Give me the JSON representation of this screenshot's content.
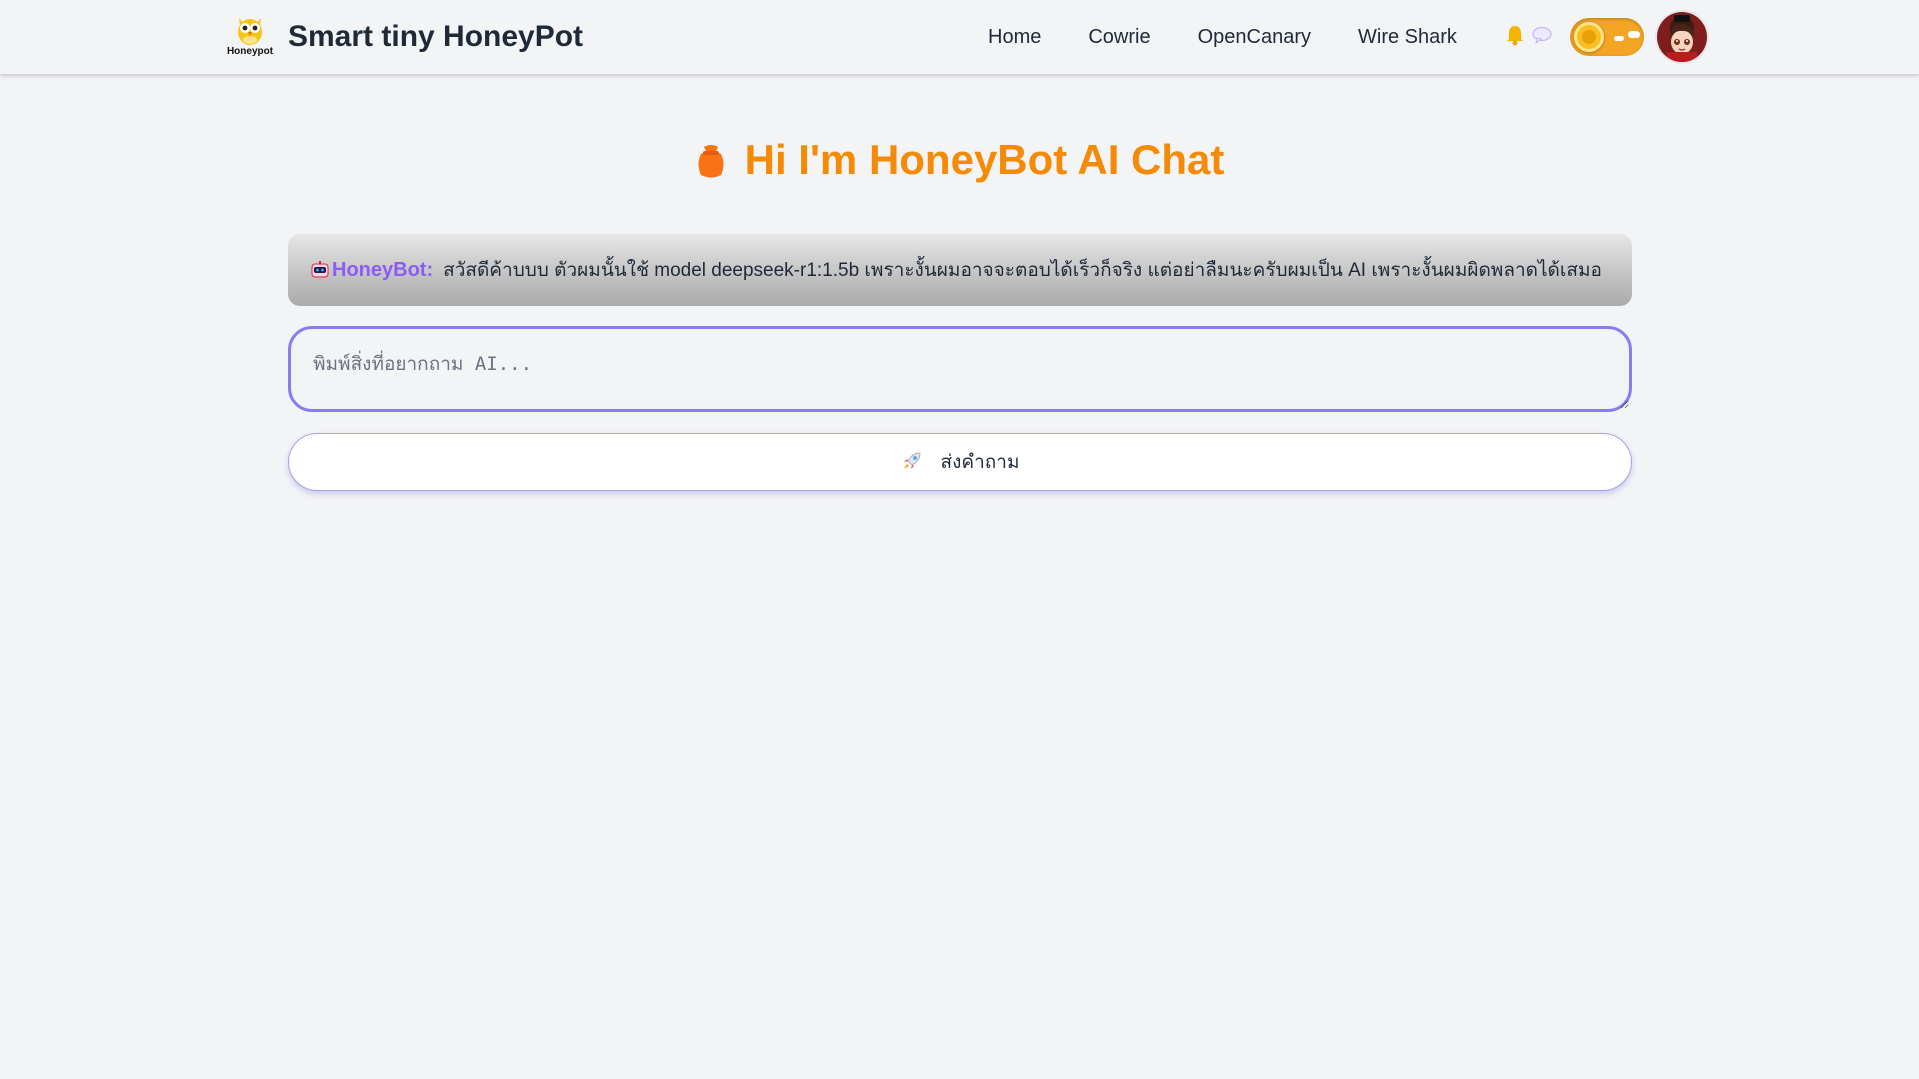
{
  "app": {
    "logo_text": "Honeypot",
    "title": "Smart tiny HoneyPot",
    "logo_icon": "owl-icon"
  },
  "nav": {
    "links": [
      {
        "label": "Home"
      },
      {
        "label": "Cowrie"
      },
      {
        "label": "OpenCanary"
      },
      {
        "label": "Wire Shark"
      }
    ],
    "icons": [
      "bell-icon",
      "chat-bubble-icon"
    ],
    "theme_toggle": "light",
    "avatar": "avatar"
  },
  "main": {
    "title": "Hi I'm HoneyBot AI Chat",
    "title_icon": "honey-pot-icon",
    "chat": {
      "messages": [
        {
          "sender": "HoneyBot:",
          "icon": "robot-icon",
          "text": "สวัสดีค้าบบบ ตัวผมนั้นใช้ model deepseek-r1:1.5b เพราะงั้นผมอาจจะตอบได้เร็วก็จริง แต่อย่าลืมนะครับผมเป็น AI เพราะงั้นผมผิดพลาดได้เสมอ"
        }
      ]
    },
    "input": {
      "value": "",
      "placeholder": "พิมพ์สิ่งที่อยากถาม AI..."
    },
    "send_button": {
      "label": "ส่งคำถาม",
      "icon": "rocket-icon"
    }
  },
  "colors": {
    "accent": "#f58a07",
    "bot_name": "#8b5cf6",
    "input_border": "#8b7cf6",
    "toggle": "#f5a524",
    "background": "#f3f4f6"
  }
}
